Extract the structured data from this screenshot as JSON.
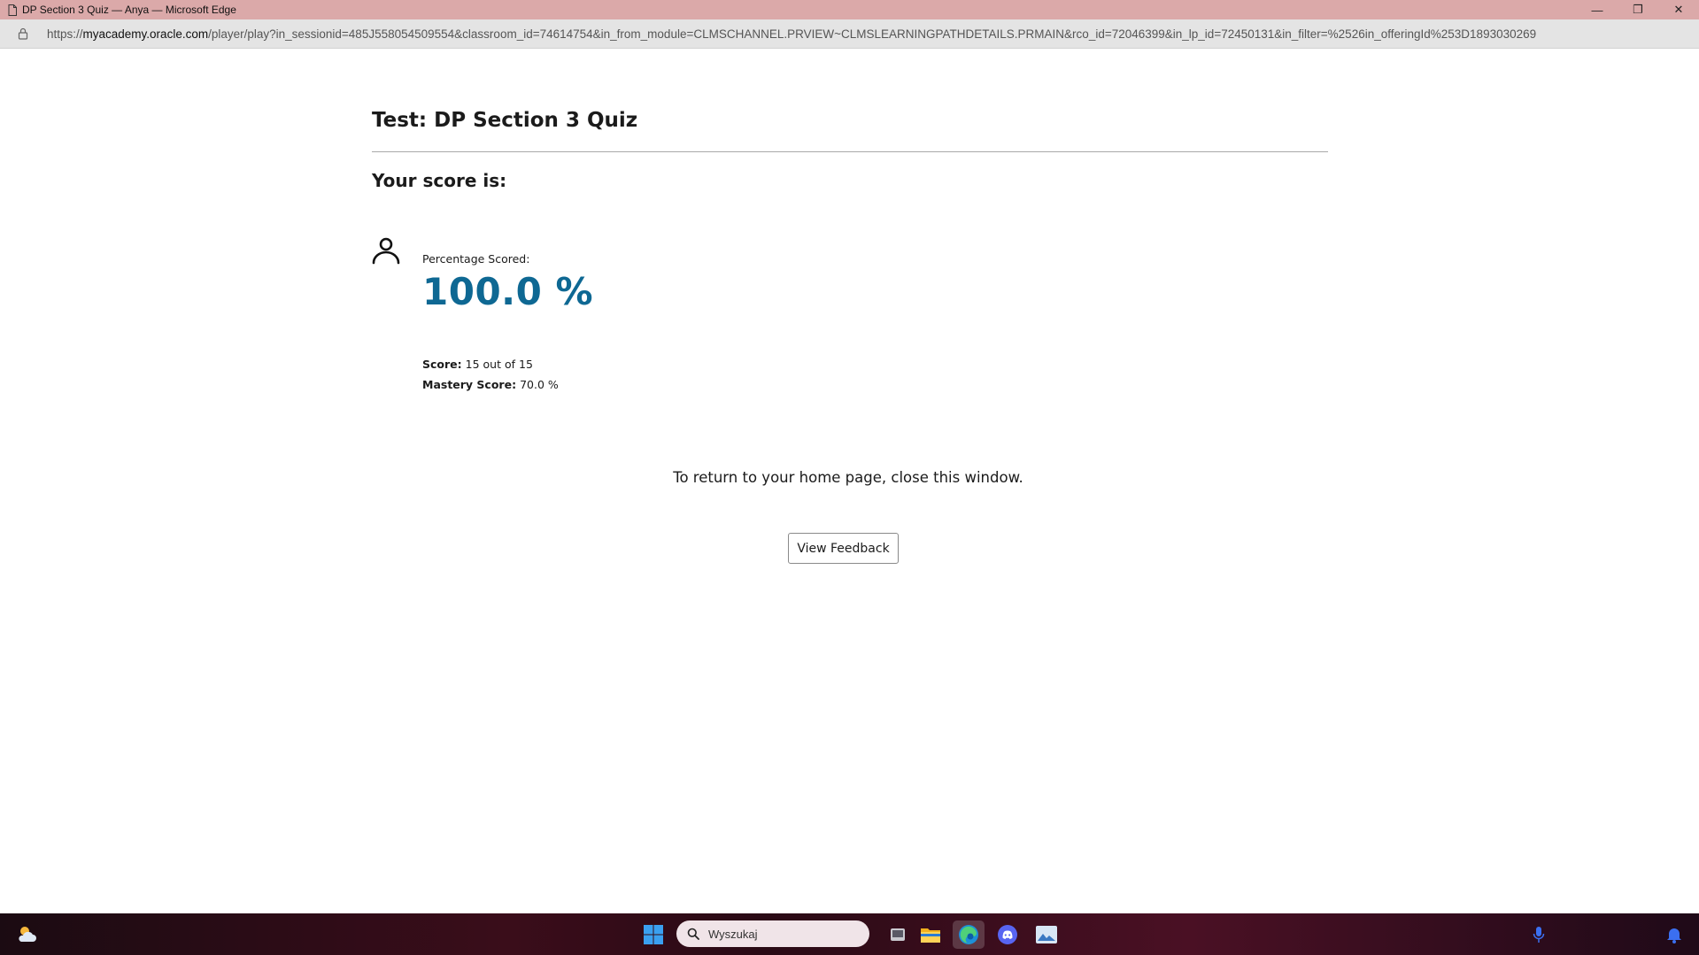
{
  "window": {
    "title": "DP Section 3 Quiz — Anya — Microsoft Edge",
    "minimize": "—",
    "restore": "❐",
    "close": "✕"
  },
  "address": {
    "scheme": "https://",
    "host": "myacademy.oracle.com",
    "path": "/player/play?in_sessionid=485J558054509554&classroom_id=74614754&in_from_module=CLMSCHANNEL.PRVIEW~CLMSLEARNINGPATHDETAILS.PRMAIN&rco_id=72046399&in_lp_id=72450131&in_filter=%2526in_offeringId%253D1893030269"
  },
  "page": {
    "title": "Test: DP Section 3 Quiz",
    "score_heading": "Your score is:",
    "percentage_label": "Percentage Scored:",
    "percentage_value": "100.0 %",
    "score_label": "Score:",
    "score_value": "15 out of 15",
    "mastery_label": "Mastery Score:",
    "mastery_value": "70.0 %",
    "return_message": "To return to your home page, close this window.",
    "feedback_button": "View Feedback"
  },
  "taskbar": {
    "search_placeholder": "Wyszukaj",
    "icons": [
      "weather-icon",
      "start-icon",
      "search-icon",
      "task-view-icon",
      "file-explorer-icon",
      "edge-icon",
      "discord-icon",
      "photos-icon",
      "microphone-icon",
      "notification-bell-icon"
    ]
  },
  "colors": {
    "titlebar": "#dba9a9",
    "score_accent": "#0e6893",
    "addressbar": "#e4e4e4"
  }
}
